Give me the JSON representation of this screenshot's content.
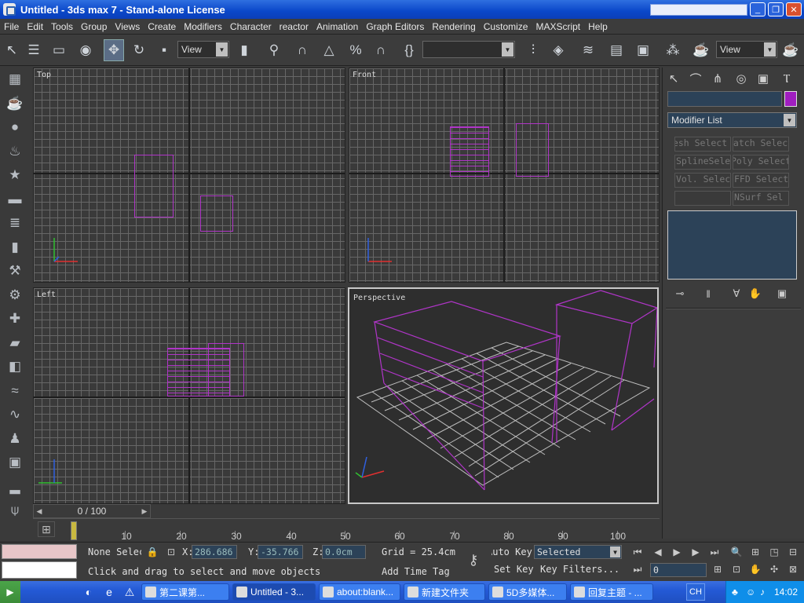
{
  "window": {
    "title": "Untitled - 3ds max 7 - Stand-alone License",
    "min_icon": "minimize-icon",
    "max_icon": "restore-icon",
    "close_icon": "close-icon",
    "min_glyph": "_",
    "max_glyph": "❐",
    "close_glyph": "✕"
  },
  "menu": [
    "File",
    "Edit",
    "Tools",
    "Group",
    "Views",
    "Create",
    "Modifiers",
    "Character",
    "reactor",
    "Animation",
    "Graph Editors",
    "Rendering",
    "Customize",
    "MAXScript",
    "Help"
  ],
  "toolbar": {
    "ref_coord": "View",
    "named_selection": "",
    "view2": "View"
  },
  "viewports": {
    "top": "Top",
    "front": "Front",
    "left": "Left",
    "perspective": "Perspective"
  },
  "command_panel": {
    "modifier_list": "Modifier List",
    "mod_buttons": [
      "Mesh Select",
      "Patch Select",
      "Poly Select",
      "SplineSelect",
      "Vol. Select",
      "FFD Select",
      "",
      "NSurf Sel"
    ],
    "object_color": "#a01ec0"
  },
  "time": {
    "slider": "0 / 100",
    "ticks": [
      "10",
      "20",
      "30",
      "40",
      "50",
      "60",
      "70",
      "80",
      "90",
      "100"
    ]
  },
  "status": {
    "selection": "None Selected",
    "x": "286.686",
    "y": "-35.766",
    "z": "0.0cm",
    "grid": "Grid = 25.4cm",
    "auto_key": "Auto Key",
    "set_key": "Set Key",
    "key_mode": "Selected",
    "key_filters": "Key Filters...",
    "prompt": "Click and drag to select and move objects",
    "add_time_tag": "Add Time Tag",
    "frame": "0"
  },
  "taskbar": {
    "tasks": [
      "第二课第...",
      "Untitled - 3...",
      "about:blank...",
      "新建文件夹",
      "5D多媒体...",
      "回复主题 - ..."
    ],
    "lang": "CH",
    "clock": "14:02"
  },
  "colors": {
    "titlebar": "#0a47c9",
    "object": "#b035c8",
    "viewport_bg": "#3a3a3a"
  }
}
